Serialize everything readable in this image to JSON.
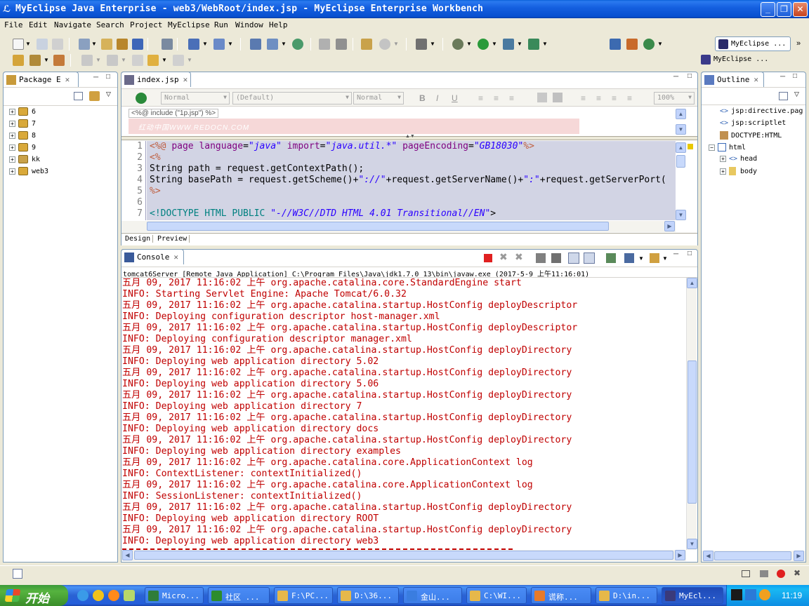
{
  "window": {
    "title": "MyEclipse Java Enterprise - web3/WebRoot/index.jsp - MyEclipse Enterprise Workbench"
  },
  "menu": [
    "File",
    "Edit",
    "Navigate",
    "Search",
    "Project",
    "MyEclipse",
    "Run",
    "Window",
    "Help"
  ],
  "perspectives": {
    "active": "MyEclipse ...",
    "other": "MyEclipse ..."
  },
  "package_explorer": {
    "title": "Package E",
    "items": [
      "6",
      "7",
      "8",
      "9",
      "kk",
      "web3"
    ]
  },
  "editor": {
    "tab": "index.jsp",
    "format_toolbar": {
      "style": "Normal",
      "font": "(Default)",
      "size": "Normal",
      "bold": "B",
      "italic": "I",
      "underline": "U",
      "zoom": "100%"
    },
    "design_preview_text": "<%@ include (\"1p.jsp\") %>",
    "watermark": "红动中国WWW.REDOCN.COM",
    "code_lines": [
      {
        "n": "1",
        "text": "<%@ page language=\"java\" import=\"java.util.*\" pageEncoding=\"GB18030\"%>"
      },
      {
        "n": "2",
        "text": "<%"
      },
      {
        "n": "3",
        "text": "String path = request.getContextPath();"
      },
      {
        "n": "4",
        "text": "String basePath = request.getScheme()+\"://\"+request.getServerName()+\":\"+request.getServerPort("
      },
      {
        "n": "5",
        "text": "%>"
      },
      {
        "n": "6",
        "text": ""
      },
      {
        "n": "7",
        "text": "<!DOCTYPE HTML PUBLIC \"-//W3C//DTD HTML 4.01 Transitional//EN\">"
      }
    ],
    "bottom_tabs": [
      "Design",
      "Preview"
    ]
  },
  "outline": {
    "title": "Outline",
    "items": [
      {
        "label": "jsp:directive.pag",
        "indent": 0
      },
      {
        "label": "jsp:scriptlet",
        "indent": 0
      },
      {
        "label": "DOCTYPE:HTML",
        "indent": 0
      },
      {
        "label": "html",
        "indent": 0
      },
      {
        "label": "head",
        "indent": 1
      },
      {
        "label": "body",
        "indent": 1
      }
    ]
  },
  "console": {
    "title": "Console",
    "header": "tomcat6Server [Remote Java Application] C:\\Program Files\\Java\\jdk1.7.0_13\\bin\\javaw.exe (2017-5-9 上午11:16:01)",
    "lines": [
      "五月 09, 2017 11:16:02 上午 org.apache.catalina.core.StandardEngine start",
      "INFO: Starting Servlet Engine: Apache Tomcat/6.0.32",
      "五月 09, 2017 11:16:02 上午 org.apache.catalina.startup.HostConfig deployDescriptor",
      "INFO: Deploying configuration descriptor host-manager.xml",
      "五月 09, 2017 11:16:02 上午 org.apache.catalina.startup.HostConfig deployDescriptor",
      "INFO: Deploying configuration descriptor manager.xml",
      "五月 09, 2017 11:16:02 上午 org.apache.catalina.startup.HostConfig deployDirectory",
      "INFO: Deploying web application directory 5.02",
      "五月 09, 2017 11:16:02 上午 org.apache.catalina.startup.HostConfig deployDirectory",
      "INFO: Deploying web application directory 5.06",
      "五月 09, 2017 11:16:02 上午 org.apache.catalina.startup.HostConfig deployDirectory",
      "INFO: Deploying web application directory 7",
      "五月 09, 2017 11:16:02 上午 org.apache.catalina.startup.HostConfig deployDirectory",
      "INFO: Deploying web application directory docs",
      "五月 09, 2017 11:16:02 上午 org.apache.catalina.startup.HostConfig deployDirectory",
      "INFO: Deploying web application directory examples",
      "五月 09, 2017 11:16:02 上午 org.apache.catalina.core.ApplicationContext log",
      "INFO: ContextListener: contextInitialized()",
      "五月 09, 2017 11:16:02 上午 org.apache.catalina.core.ApplicationContext log",
      "INFO: SessionListener: contextInitialized()",
      "五月 09, 2017 11:16:02 上午 org.apache.catalina.startup.HostConfig deployDirectory",
      "INFO: Deploying web application directory ROOT",
      "五月 09, 2017 11:16:02 上午 org.apache.catalina.startup.HostConfig deployDirectory",
      "INFO: Deploying web application directory web3"
    ]
  },
  "taskbar": {
    "start_label": "开始",
    "tasks": [
      {
        "label": "Micro...",
        "color": "#2f7d3a"
      },
      {
        "label": "社区 ...",
        "color": "#2c8c2c"
      },
      {
        "label": "F:\\PC...",
        "color": "#e6b84a"
      },
      {
        "label": "D:\\36...",
        "color": "#e6b84a"
      },
      {
        "label": "金山...",
        "color": "#3a7de0"
      },
      {
        "label": "C:\\WI...",
        "color": "#e6b84a"
      },
      {
        "label": "谎称...",
        "color": "#e67a2a"
      },
      {
        "label": "D:\\in...",
        "color": "#e6b84a"
      },
      {
        "label": "MyEcl...",
        "color": "#3a3a7a"
      }
    ],
    "clock": "11:19"
  },
  "colors": {
    "console_text": "#c00000",
    "code_bg": "#d2d4e4",
    "keyword": "#7f007f",
    "string": "#2a00ff"
  }
}
